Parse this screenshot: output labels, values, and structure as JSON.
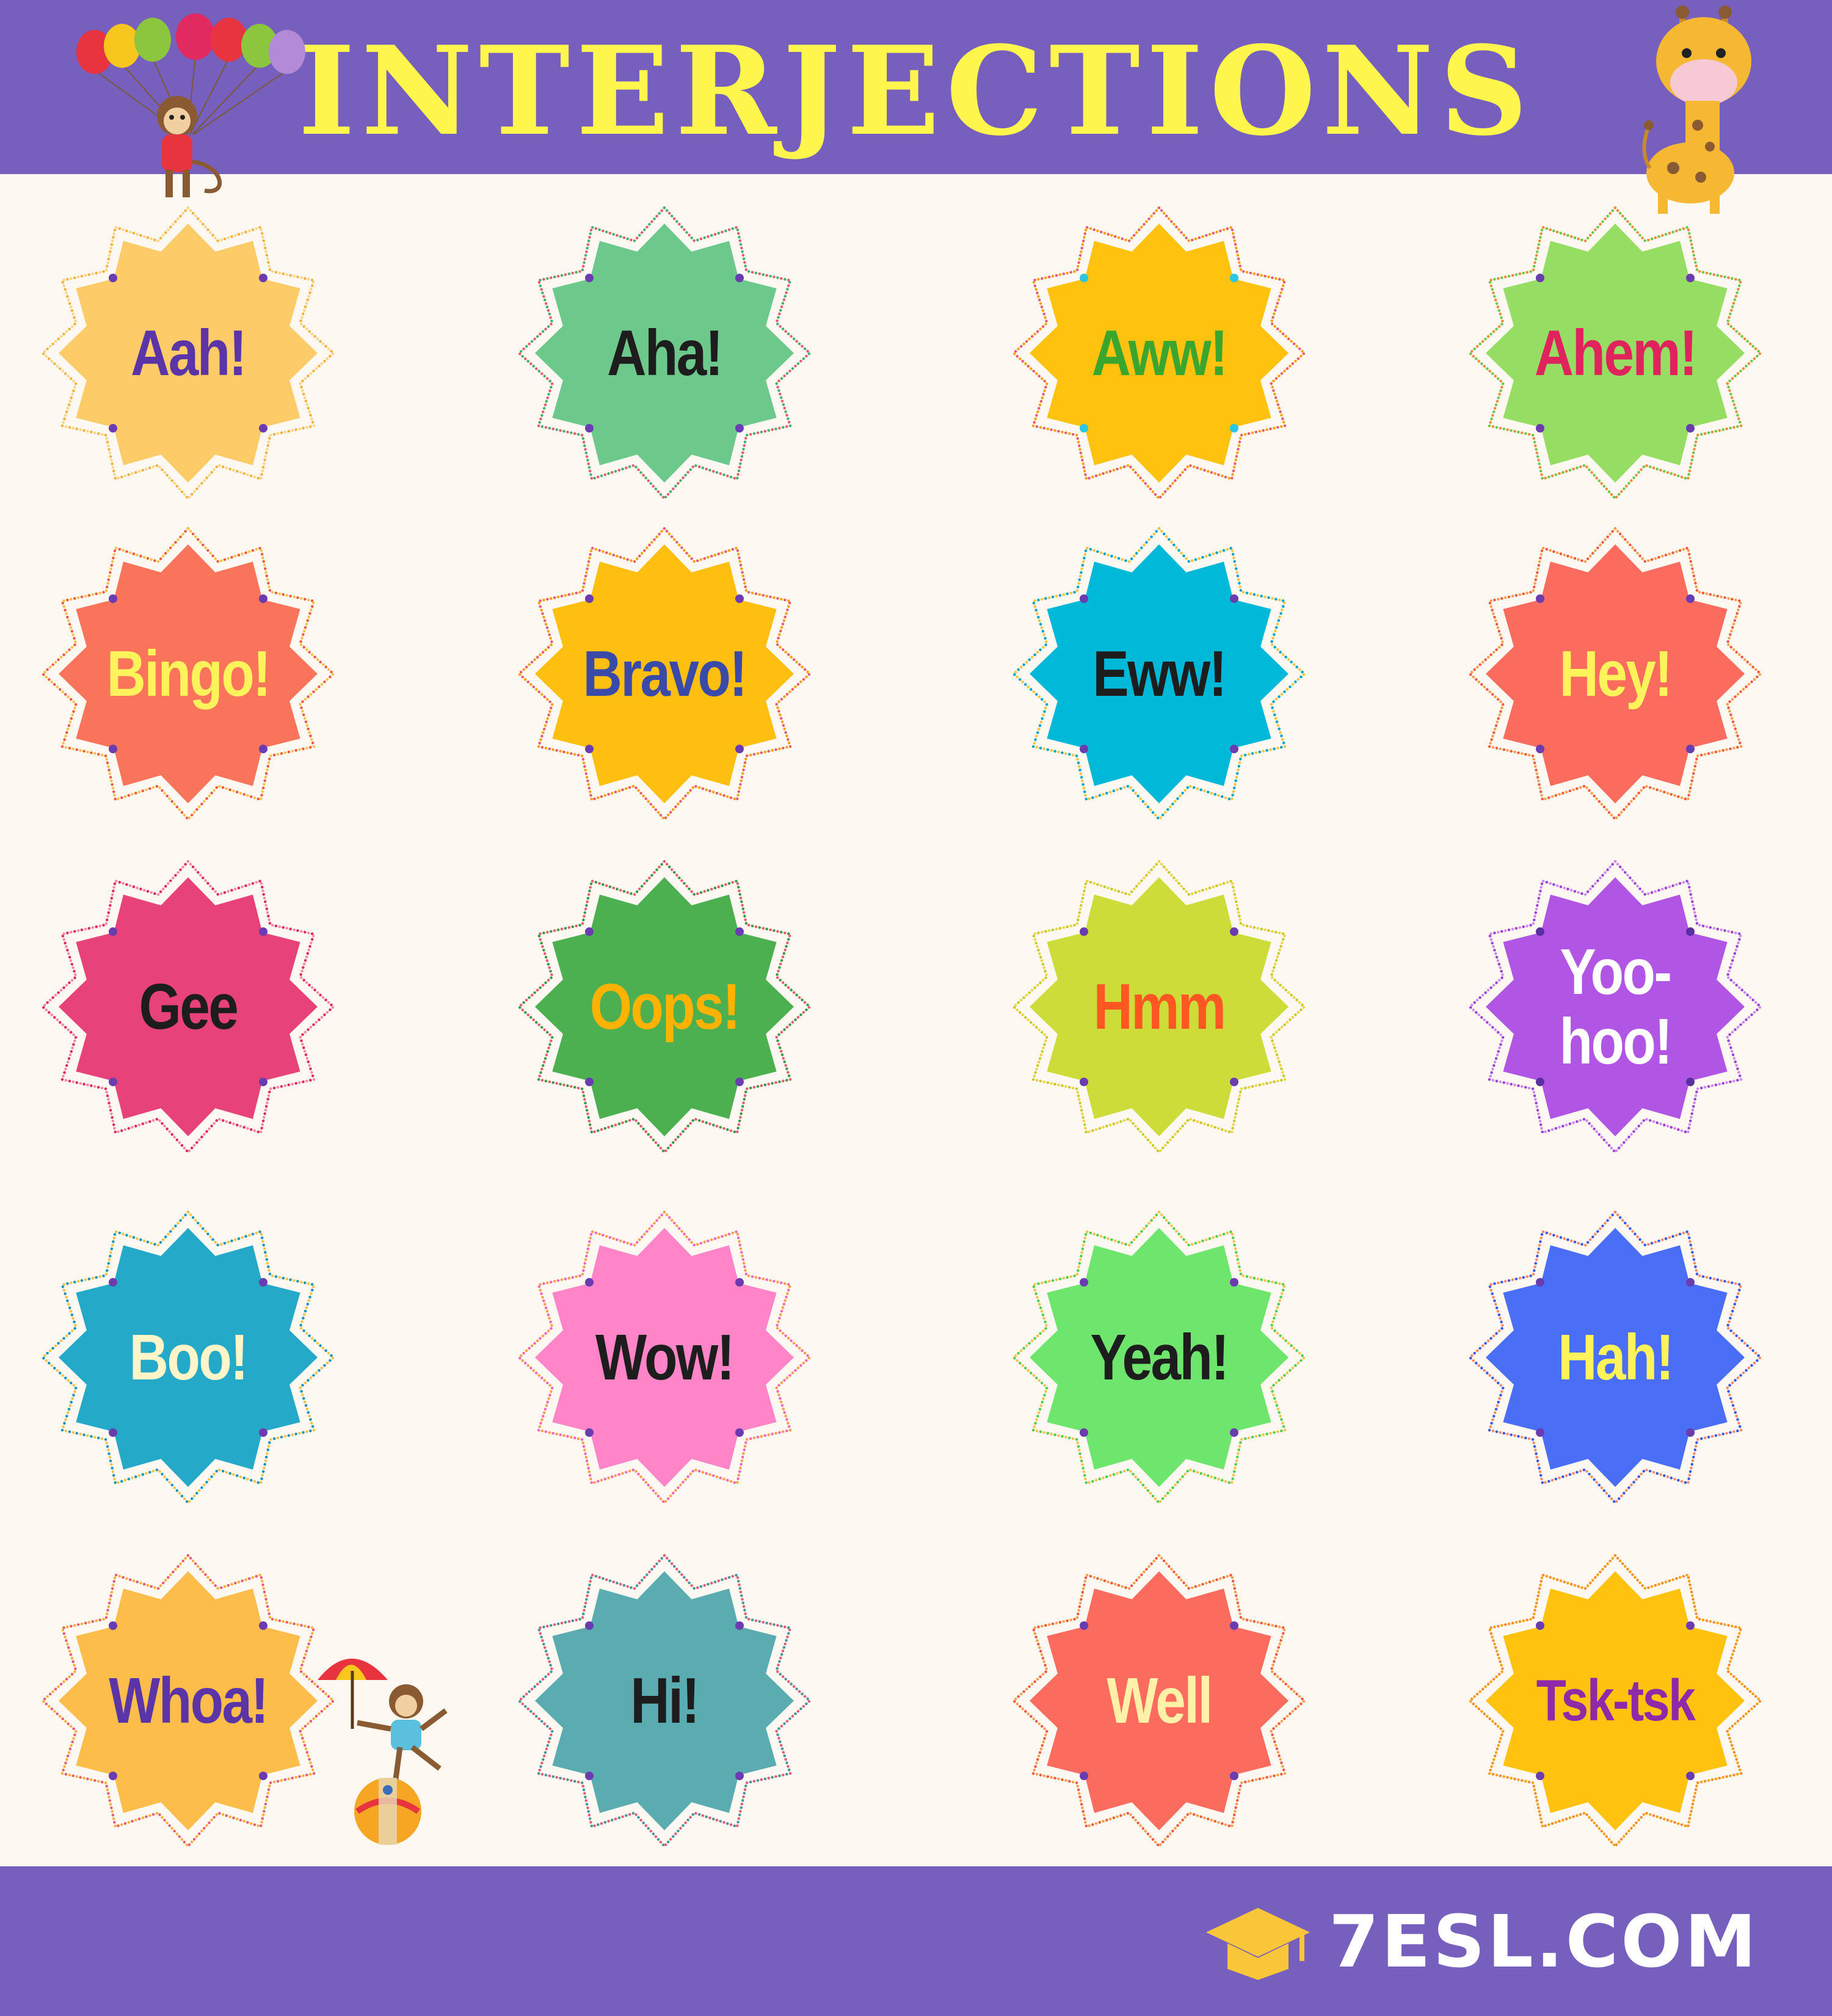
{
  "header": {
    "title": "INTERJECTIONS"
  },
  "footer": {
    "brand": "7ESL.COM"
  },
  "colors": {
    "banner": "#765fbd",
    "title_text": "#fff64d",
    "background": "#fdf9f2",
    "brand_logo": "#f9c63a"
  },
  "decorations": {
    "top_left": "monkey-with-balloons",
    "top_right": "giraffe",
    "bottom": "monkey-with-umbrella-on-ball"
  },
  "badges": [
    {
      "text": "Aah!",
      "fill": "#fdcb67",
      "text_color": "#5b35a8",
      "ring": [
        "#fbb03b",
        "#f7d58a"
      ],
      "dot": "#6a3cb0"
    },
    {
      "text": "Aha!",
      "fill": "#6cc88b",
      "text_color": "#1d1d1d",
      "ring": [
        "#e85d75",
        "#47b36a"
      ],
      "dot": "#6a3cb0"
    },
    {
      "text": "Aww!",
      "fill": "#fec20f",
      "text_color": "#3aa62e",
      "ring": [
        "#f7a400",
        "#e85d75"
      ],
      "dot": "#2cc6e0"
    },
    {
      "text": "Ahem!",
      "fill": "#95de63",
      "text_color": "#e0225d",
      "ring": [
        "#6dc94a",
        "#f08a3c"
      ],
      "dot": "#6a3cb0"
    },
    {
      "text": "Bingo!",
      "fill": "#f9745a",
      "text_color": "#fff35c",
      "ring": [
        "#f25a46",
        "#f7c24a"
      ],
      "dot": "#6a3cb0"
    },
    {
      "text": "Bravo!",
      "fill": "#ffbf10",
      "text_color": "#3a4aa8",
      "ring": [
        "#f7a400",
        "#e85d75"
      ],
      "dot": "#6a3cb0"
    },
    {
      "text": "Eww!",
      "fill": "#00b8d8",
      "text_color": "#1d1d1d",
      "ring": [
        "#00a5c8",
        "#f4c542"
      ],
      "dot": "#6a3cb0"
    },
    {
      "text": "Hey!",
      "fill": "#fb6b5e",
      "text_color": "#fff35c",
      "ring": [
        "#f25a46",
        "#f7a24a"
      ],
      "dot": "#6a3cb0"
    },
    {
      "text": "Gee",
      "fill": "#e8427a",
      "text_color": "#1d1d1d",
      "ring": [
        "#e02a60",
        "#f78aa8"
      ],
      "dot": "#6a3cb0"
    },
    {
      "text": "Oops!",
      "fill": "#4caf50",
      "text_color": "#ffb300",
      "ring": [
        "#3d9b43",
        "#e85d75"
      ],
      "dot": "#6a3cb0"
    },
    {
      "text": "Hmm",
      "fill": "#cddc39",
      "text_color": "#ff5722",
      "ring": [
        "#bfcf2a",
        "#f7d04a"
      ],
      "dot": "#6a3cb0"
    },
    {
      "text": "Yoo-\nhoo!",
      "fill": "#b156e4",
      "text_color": "#ffffff",
      "ring": [
        "#9c45d4",
        "#d28af0"
      ],
      "dot": "#5a2fa0"
    },
    {
      "text": "Boo!",
      "fill": "#25a9c9",
      "text_color": "#fff5c8",
      "ring": [
        "#1a96b8",
        "#f7c24a"
      ],
      "dot": "#6a3cb0"
    },
    {
      "text": "Wow!",
      "fill": "#ff84c8",
      "text_color": "#1d1d1d",
      "ring": [
        "#ff66b6",
        "#f7a24a"
      ],
      "dot": "#6a3cb0"
    },
    {
      "text": "Yeah!",
      "fill": "#6ee66e",
      "text_color": "#1d1d1d",
      "ring": [
        "#4fd14f",
        "#f7c24a"
      ],
      "dot": "#6a3cb0"
    },
    {
      "text": "Hah!",
      "fill": "#4a6ef5",
      "text_color": "#fff35c",
      "ring": [
        "#3c5ae6",
        "#ff8a65"
      ],
      "dot": "#6a3cb0"
    },
    {
      "text": "Whoa!",
      "fill": "#fdbd4a",
      "text_color": "#5b35a8",
      "ring": [
        "#fbb03b",
        "#e85d75"
      ],
      "dot": "#6a3cb0"
    },
    {
      "text": "Hi!",
      "fill": "#5aacb0",
      "text_color": "#1d1d1d",
      "ring": [
        "#47979c",
        "#e85d75"
      ],
      "dot": "#6a3cb0"
    },
    {
      "text": "Well",
      "fill": "#fb6b5e",
      "text_color": "#fff1a8",
      "ring": [
        "#f25a46",
        "#f7a24a"
      ],
      "dot": "#6a3cb0"
    },
    {
      "text": "Tsk-tsk",
      "fill": "#fec20f",
      "text_color": "#8e2aa8",
      "ring": [
        "#f7a400",
        "#f58a3c"
      ],
      "dot": "#6a3cb0"
    }
  ]
}
